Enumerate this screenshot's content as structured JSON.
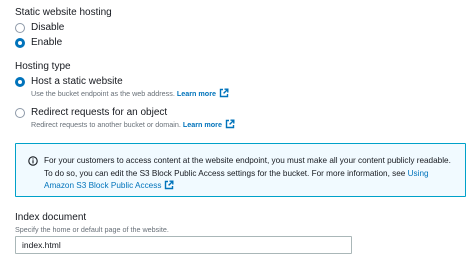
{
  "hosting": {
    "label": "Static website hosting",
    "options": [
      {
        "label": "Disable",
        "selected": false
      },
      {
        "label": "Enable",
        "selected": true
      }
    ]
  },
  "hosting_type": {
    "label": "Hosting type",
    "options": [
      {
        "label": "Host a static website",
        "description": "Use the bucket endpoint as the web address.",
        "link": "Learn more",
        "selected": true
      },
      {
        "label": "Redirect requests for an object",
        "description": "Redirect requests to another bucket or domain.",
        "link": "Learn more",
        "selected": false
      }
    ]
  },
  "info": {
    "text": "For your customers to access content at the website endpoint, you must make all your content publicly readable. To do so, you can edit the S3 Block Public Access settings for the bucket. For more information, see",
    "link": "Using Amazon S3 Block Public Access",
    "accent_color": "#00a1c9",
    "background_color": "#f1faff"
  },
  "index_document": {
    "label": "Index document",
    "description": "Specify the home or default page of the website.",
    "value": "index.html"
  },
  "colors": {
    "primary": "#0073bb",
    "text": "#16191f",
    "secondary_text": "#687078"
  }
}
